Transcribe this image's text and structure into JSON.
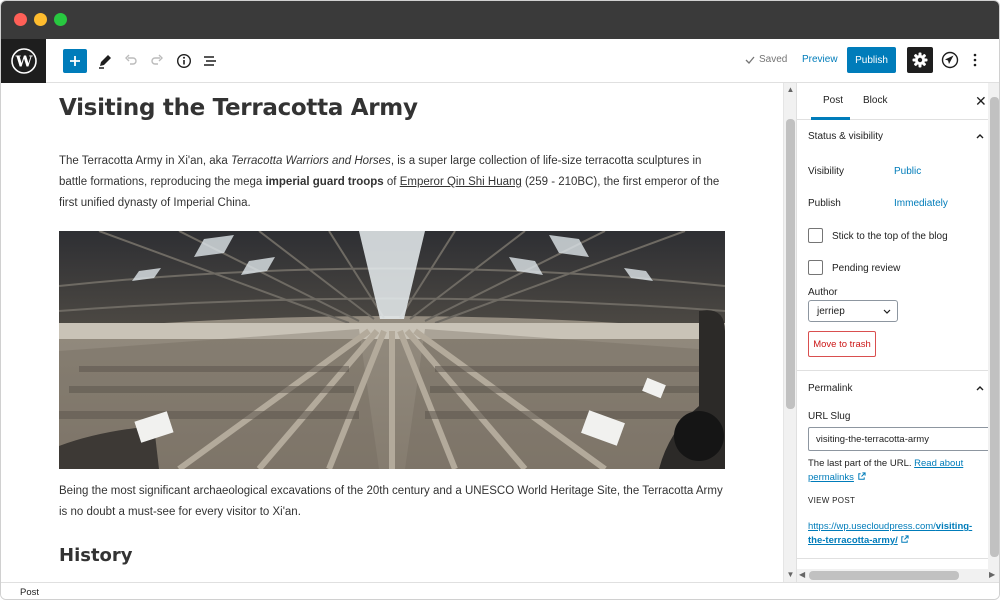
{
  "toolbar": {
    "saved_label": "Saved",
    "preview_label": "Preview",
    "publish_label": "Publish"
  },
  "post": {
    "title": "Visiting the Terracotta Army",
    "intro": {
      "t1": "The Terracotta Army in Xi'an, aka ",
      "t2": "Terracotta Warriors and Horses",
      "t3": ", is a super large collection of life-size terracotta sculptures in battle formations, reproducing the mega ",
      "t4": "imperial guard troops",
      "t5": " of ",
      "t6": "Emperor Qin Shi Huang",
      "t7": " (259 - 210BC), the first emperor of the first unified dynasty of Imperial China."
    },
    "para2": "Being the most significant archaeological excavations of the 20th century and a UNESCO World Heritage Site, the Terracotta Army is no doubt a must-see for every visitor to Xi'an.",
    "heading2": "History"
  },
  "sidebar": {
    "tabs": [
      {
        "label": "Post"
      },
      {
        "label": "Block"
      }
    ],
    "status": {
      "heading": "Status & visibility",
      "visibility_label": "Visibility",
      "visibility_value": "Public",
      "publish_label": "Publish",
      "publish_value": "Immediately",
      "sticky_label": "Stick to the top of the blog",
      "pending_label": "Pending review",
      "author_label": "Author",
      "author_value": "jerriep",
      "trash_label": "Move to trash"
    },
    "permalink": {
      "heading": "Permalink",
      "slug_label": "URL Slug",
      "slug_value": "visiting-the-terracotta-army",
      "help_text": "The last part of the URL. ",
      "help_link": "Read about permalinks",
      "view_post_label": "VIEW POST",
      "url_prefix": "https://wp.usecloudpress.com/",
      "url_slug": "visiting-the-terracotta-army/"
    }
  },
  "footer": {
    "breadcrumb": "Post"
  },
  "colors": {
    "accent": "#007cba",
    "dark": "#1e1e1e",
    "danger": "#cc1818"
  }
}
